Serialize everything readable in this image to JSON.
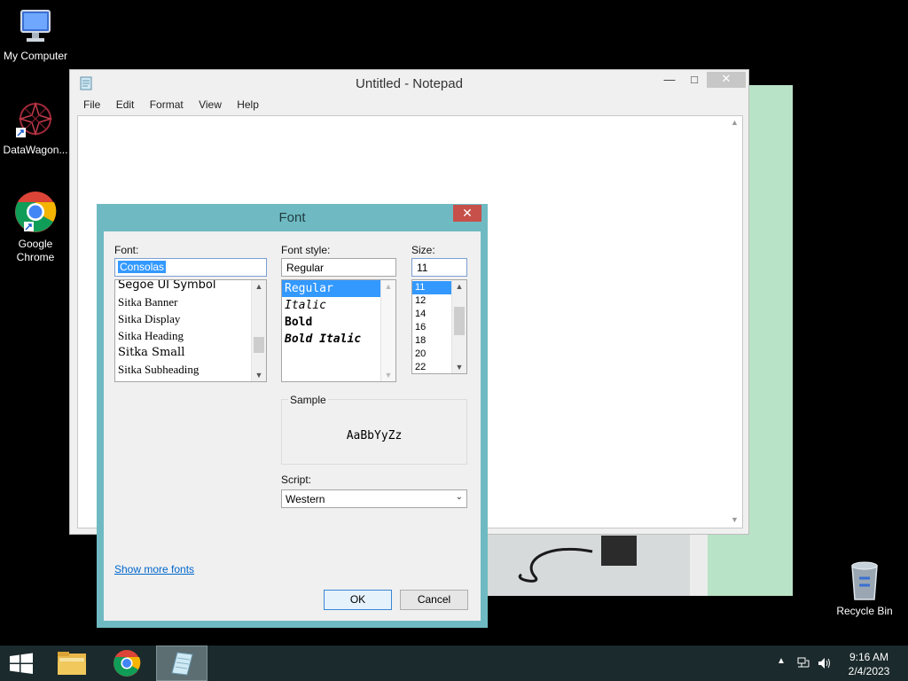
{
  "desktop": {
    "icons": [
      {
        "label": "My Computer"
      },
      {
        "label": "DataWagon..."
      },
      {
        "label": "Google\nChrome"
      },
      {
        "label": "Recycle Bin"
      }
    ]
  },
  "notepad": {
    "title": "Untitled - Notepad",
    "menu": [
      "File",
      "Edit",
      "Format",
      "View",
      "Help"
    ]
  },
  "font_dialog": {
    "title": "Font",
    "font_label": "Font:",
    "font_value": "Consolas",
    "font_list": [
      "Segoe UI Symbol",
      "Sitka Banner",
      "Sitka Display",
      "Sitka Heading",
      "Sitka Small",
      "Sitka Subheading"
    ],
    "style_label": "Font style:",
    "style_value": "Regular",
    "style_list": [
      "Regular",
      "Italic",
      "Bold",
      "Bold Italic"
    ],
    "size_label": "Size:",
    "size_value": "11",
    "size_list": [
      "11",
      "12",
      "14",
      "16",
      "18",
      "20",
      "22"
    ],
    "sample_label": "Sample",
    "sample_text": "AaBbYyZz",
    "script_label": "Script:",
    "script_value": "Western",
    "show_more": "Show more fonts",
    "ok": "OK",
    "cancel": "Cancel"
  },
  "taskbar": {
    "time": "9:16 AM",
    "date": "2/4/2023"
  },
  "colors": {
    "dialog_frame": "#6fbac2",
    "selection": "#3399ff",
    "close_red": "#c7504a",
    "link": "#0066cc"
  }
}
